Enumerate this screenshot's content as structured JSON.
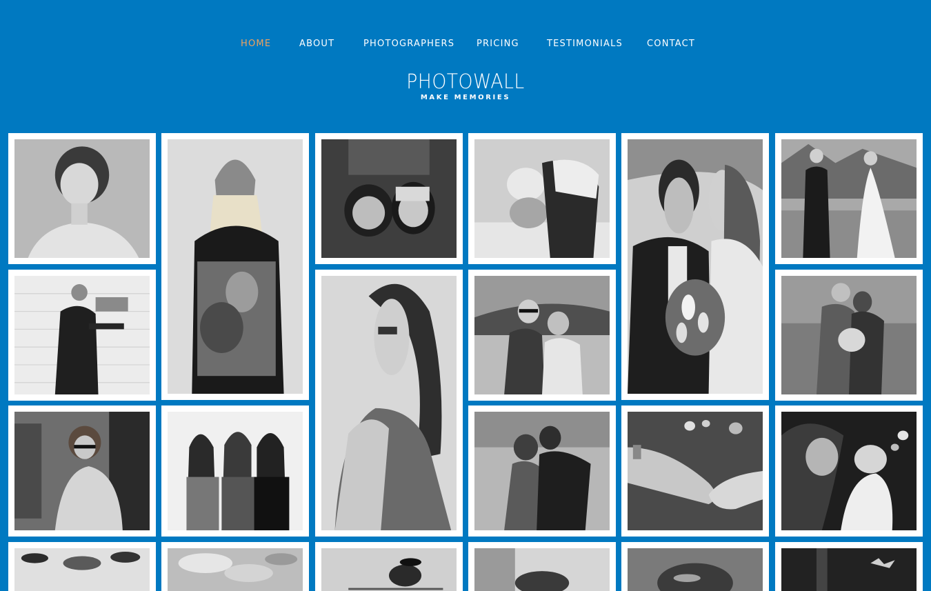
{
  "nav": {
    "items": [
      {
        "label": "HOME",
        "active": true
      },
      {
        "label": "ABOUT",
        "active": false
      },
      {
        "label": "PHOTOGRAPHERS",
        "active": false
      },
      {
        "label": "PRICING",
        "active": false
      },
      {
        "label": "TESTIMONIALS",
        "active": false
      },
      {
        "label": "CONTACT",
        "active": false
      }
    ]
  },
  "brand": {
    "title": "PHOTOWALL",
    "tagline": "MAKE MEMORIES"
  },
  "colors": {
    "background": "#0079c1",
    "nav_active": "#f0a35e",
    "nav_text": "#ffffff",
    "frame": "#ffffff"
  },
  "gallery": {
    "photos": [
      {
        "name": "photo-woman-portrait"
      },
      {
        "name": "photo-woman-beanie-holding-picture"
      },
      {
        "name": "photo-two-women-lying-covering-eyes"
      },
      {
        "name": "photo-couple-piggyback-laughing"
      },
      {
        "name": "photo-wedding-couple-bouquet"
      },
      {
        "name": "photo-wedding-couple-lakeside"
      },
      {
        "name": "photo-man-hanging-pictures"
      },
      {
        "name": "photo-woman-wavy-hair-glamour"
      },
      {
        "name": "photo-couple-sunglasses-lake"
      },
      {
        "name": "photo-pregnant-couple-forest"
      },
      {
        "name": "photo-woman-sunglasses-sitting"
      },
      {
        "name": "photo-three-women-from-behind"
      },
      {
        "name": "photo-couple-kissing-street"
      },
      {
        "name": "photo-hands-engagement-ring"
      },
      {
        "name": "photo-mother-holding-baby"
      },
      {
        "name": "photo-flowers-overhead"
      },
      {
        "name": "photo-balloons-party"
      },
      {
        "name": "photo-bird-on-branch"
      },
      {
        "name": "photo-dog-on-bed"
      },
      {
        "name": "photo-monkey-closeup"
      },
      {
        "name": "photo-dark-forest-animal"
      }
    ]
  }
}
